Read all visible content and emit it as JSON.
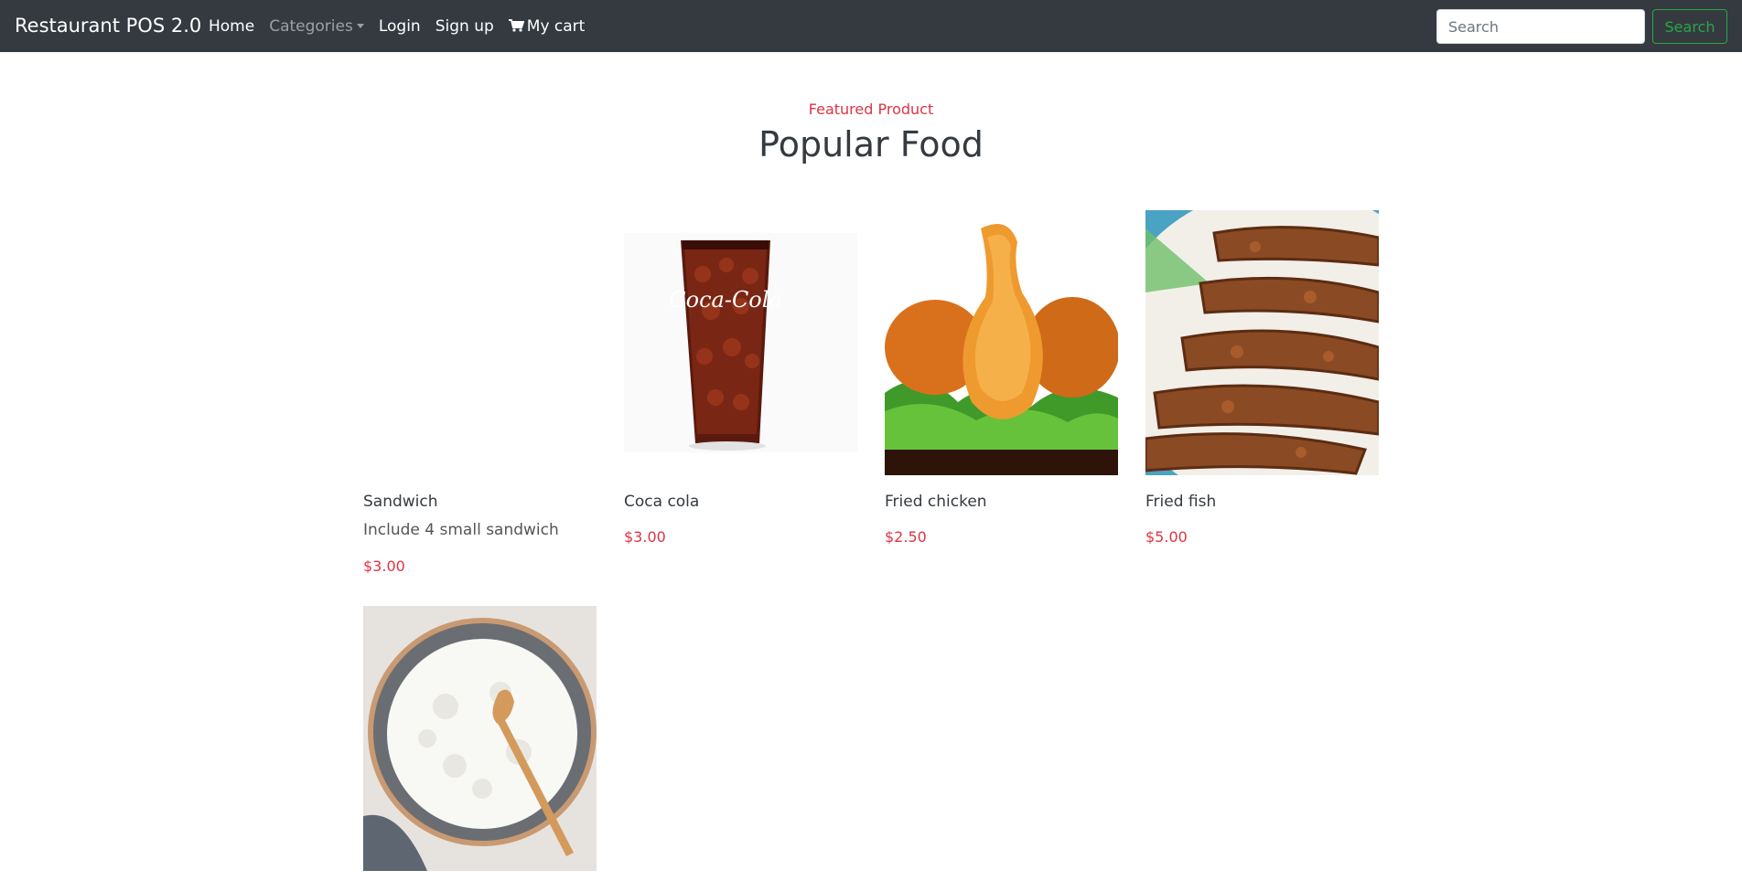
{
  "navbar": {
    "brand": "Restaurant POS 2.0",
    "links": [
      {
        "label": "Home"
      },
      {
        "label": "Categories"
      },
      {
        "label": "Login"
      },
      {
        "label": "Sign up"
      },
      {
        "label": "My cart",
        "icon": "cart-icon"
      }
    ],
    "search": {
      "placeholder": "Search",
      "value": "",
      "button_label": "Search"
    }
  },
  "colors": {
    "navbar_bg": "#343a40",
    "accent_red": "#dc3545",
    "search_green": "#28a745"
  },
  "section": {
    "label": "Featured Product",
    "title": "Popular Food"
  },
  "products": [
    {
      "name": "Sandwich",
      "description": "Include 4 small sandwich",
      "price": "$3.00",
      "image": "blank-image"
    },
    {
      "name": "Coca cola",
      "description": "",
      "price": "$3.00",
      "image": "cola-glass-image"
    },
    {
      "name": "Fried chicken",
      "description": "",
      "price": "$2.50",
      "image": "fried-chicken-image"
    },
    {
      "name": "Fried fish",
      "description": "",
      "price": "$5.00",
      "image": "fried-fish-image"
    },
    {
      "name": "",
      "description": "",
      "price": "",
      "image": "rice-bowl-image"
    }
  ]
}
